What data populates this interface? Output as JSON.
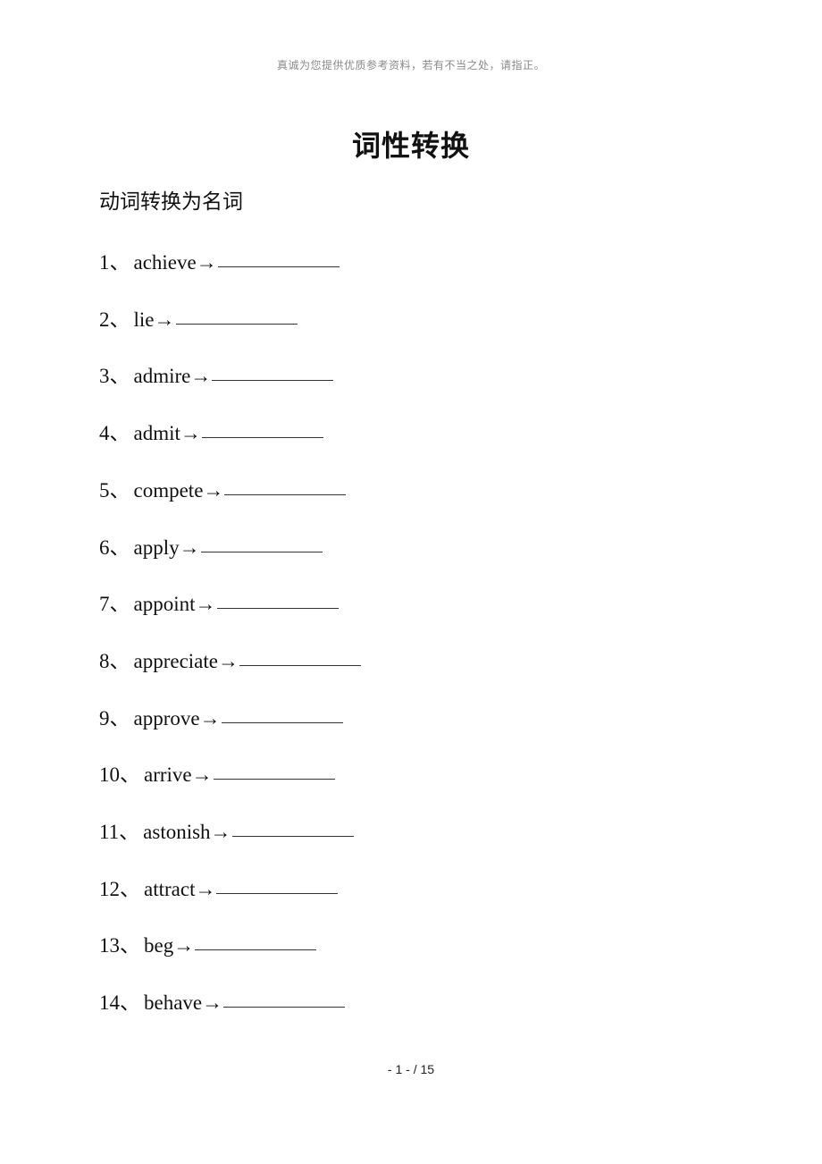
{
  "header_note": "真诚为您提供优质参考资料，若有不当之处，请指正。",
  "title": "词性转换",
  "section_heading": "动词转换为名词",
  "separator": "、",
  "arrow": "→",
  "items": [
    {
      "number": "1",
      "word": "achieve"
    },
    {
      "number": "2",
      "word": "lie"
    },
    {
      "number": "3",
      "word": "admire"
    },
    {
      "number": "4",
      "word": "admit"
    },
    {
      "number": "5",
      "word": "compete"
    },
    {
      "number": "6",
      "word": "apply"
    },
    {
      "number": "7",
      "word": "appoint"
    },
    {
      "number": "8",
      "word": "appreciate"
    },
    {
      "number": "9",
      "word": "approve"
    },
    {
      "number": "10",
      "word": "arrive"
    },
    {
      "number": "11",
      "word": "astonish"
    },
    {
      "number": "12",
      "word": "attract"
    },
    {
      "number": "13",
      "word": "beg"
    },
    {
      "number": "14",
      "word": "behave"
    }
  ],
  "footer": {
    "page_label": "- 1 -  / 15"
  }
}
